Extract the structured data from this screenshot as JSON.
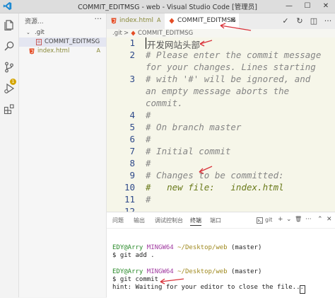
{
  "window": {
    "title": "COMMIT_EDITMSG - web - Visual Studio Code [管理员]",
    "minimize_glyph": "—",
    "maximize_glyph": "☐",
    "close_glyph": "✕"
  },
  "activity_bar": {
    "icons": [
      "files-icon",
      "search-icon",
      "source-control-icon",
      "run-debug-icon",
      "extensions-icon"
    ],
    "scm_badge": "1"
  },
  "sidebar": {
    "title": "资源...",
    "more_glyph": "···",
    "tree": [
      {
        "name": ".git",
        "type": "folder",
        "twisty": "⌄",
        "status": ""
      },
      {
        "name": "COMMIT_EDITMSG",
        "type": "file",
        "twisty": "",
        "status": ""
      },
      {
        "name": "index.html",
        "type": "html-file",
        "twisty": "",
        "status": "A"
      }
    ]
  },
  "tabs": [
    {
      "label": "index.html",
      "status": "A",
      "active": false
    },
    {
      "label": "COMMIT_EDITMSG",
      "close": "✕",
      "active": true
    }
  ],
  "editor_actions": [
    "✓",
    "↻",
    "◫",
    "···"
  ],
  "breadcrumb": {
    "folder": ".git",
    "sep": ">",
    "file": "COMMIT_EDITMSG"
  },
  "editor": {
    "lines": [
      {
        "n": "1",
        "text": "开发网站头部",
        "comment": false
      },
      {
        "n": "2",
        "text": "# Please enter the commit message",
        "comment": true
      },
      {
        "n": "",
        "text": "for your changes. Lines starting",
        "comment": true
      },
      {
        "n": "3",
        "text": "# with '#' will be ignored, and",
        "comment": true
      },
      {
        "n": "",
        "text": "an empty message aborts the",
        "comment": true
      },
      {
        "n": "",
        "text": "commit.",
        "comment": true
      },
      {
        "n": "4",
        "text": "#",
        "comment": true
      },
      {
        "n": "5",
        "text": "# On branch master",
        "comment": true
      },
      {
        "n": "6",
        "text": "#",
        "comment": true
      },
      {
        "n": "7",
        "text": "# Initial commit",
        "comment": true
      },
      {
        "n": "8",
        "text": "#",
        "comment": true
      },
      {
        "n": "9",
        "text": "# Changes to be committed:",
        "comment": true
      },
      {
        "n": "10",
        "text": "#   new file:   index.html",
        "comment": true
      },
      {
        "n": "11",
        "text": "#",
        "comment": true
      },
      {
        "n": "12",
        "text": "",
        "comment": false
      }
    ]
  },
  "panel": {
    "tabs": [
      "问题",
      "输出",
      "调试控制台",
      "终端",
      "端口"
    ],
    "active_tab": "终端",
    "terminal_name": "git",
    "controls": [
      "+",
      "⌄",
      "🗑",
      "···",
      "⌃",
      "✕"
    ],
    "terminal": [
      {
        "user": "EDY@Arry",
        "host": "MINGW64",
        "path": "~/Desktop/web",
        "branch": "(master)"
      },
      {
        "cmd": "$ git add ."
      },
      {
        "user": "EDY@Arry",
        "host": "MINGW64",
        "path": "~/Desktop/web",
        "branch": "(master)"
      },
      {
        "cmd": "$ git commit"
      },
      {
        "cmd": "hint: Waiting for your editor to close the file..."
      }
    ]
  },
  "colors": {
    "accent": "#005fb8",
    "annotation_arrow": "#d9323a",
    "editor_bg": "#f6f6e9",
    "line_number": "#2f4a8a",
    "comment": "#858585",
    "git_added": "#8a8a3a"
  }
}
